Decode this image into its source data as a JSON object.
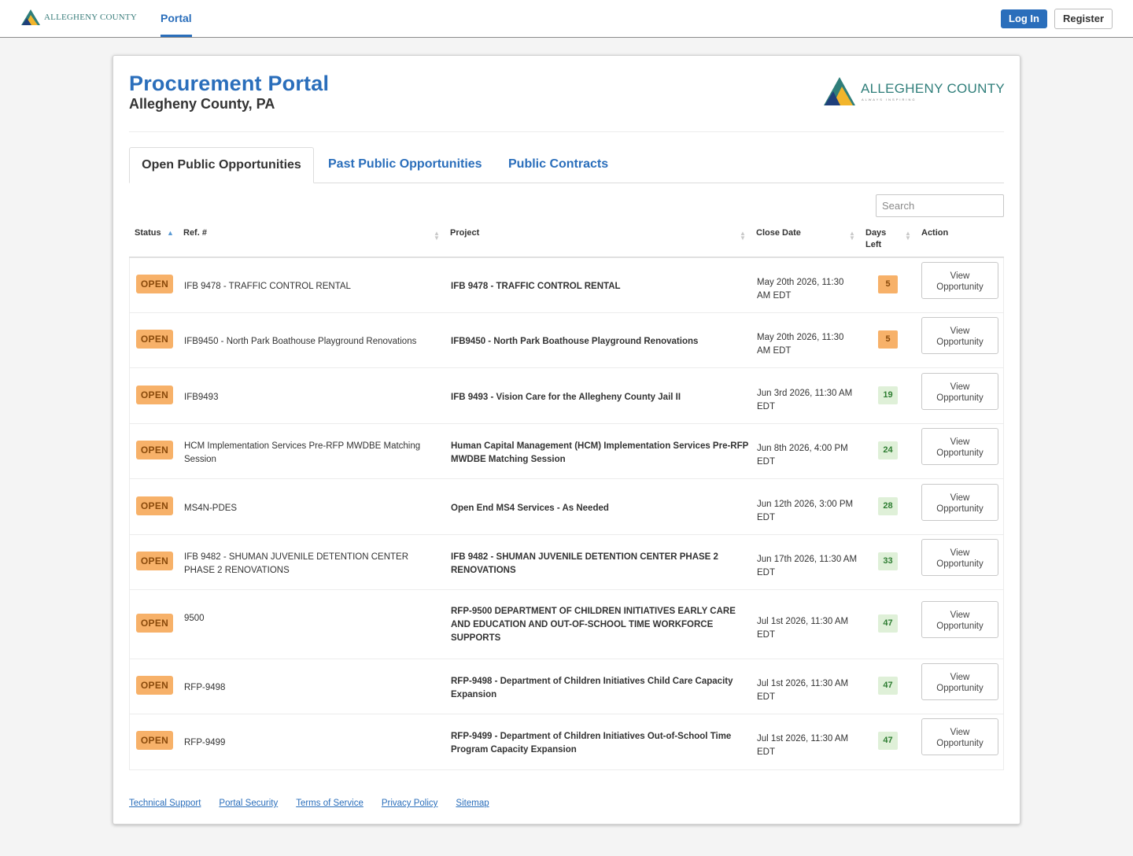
{
  "topnav": {
    "brand_text": "ALLEGHENY COUNTY",
    "brand_tag": "ALWAYS INSPIRING",
    "portal_label": "Portal",
    "login_label": "Log In",
    "register_label": "Register"
  },
  "header": {
    "title": "Procurement Portal",
    "subtitle": "Allegheny County, PA",
    "logo_text": "ALLEGHENY COUNTY",
    "logo_tag": "ALWAYS INSPIRING"
  },
  "tabs": [
    {
      "label": "Open Public Opportunities",
      "active": true
    },
    {
      "label": "Past Public Opportunities",
      "active": false
    },
    {
      "label": "Public Contracts",
      "active": false
    }
  ],
  "search": {
    "placeholder": "Search"
  },
  "table": {
    "columns": {
      "status": "Status",
      "ref": "Ref. #",
      "project": "Project",
      "close_date": "Close Date",
      "days_left_1": "Days",
      "days_left_2": "Left",
      "action": "Action"
    },
    "action_line1": "View",
    "action_line2": "Opportunity",
    "rows": [
      {
        "status": "OPEN",
        "ref": "IFB 9478 - TRAFFIC CONTROL RENTAL",
        "project": "IFB 9478 - TRAFFIC CONTROL RENTAL",
        "close": "May 20th 2026, 11:30 AM EDT",
        "days": "5",
        "urgency": "warn"
      },
      {
        "status": "OPEN",
        "ref": "IFB9450 - North Park Boathouse Playground Renovations",
        "project": "IFB9450 - North Park Boathouse Playground Renovations",
        "close": "May 20th 2026, 11:30 AM EDT",
        "days": "5",
        "urgency": "warn"
      },
      {
        "status": "OPEN",
        "ref": "IFB9493",
        "project": "IFB 9493 - Vision Care for the Allegheny County Jail II",
        "close": "Jun 3rd 2026, 11:30 AM EDT",
        "days": "19",
        "urgency": "ok"
      },
      {
        "status": "OPEN",
        "ref": "HCM Implementation Services Pre-RFP MWDBE Matching Session",
        "project": "Human Capital Management (HCM) Implementation Services Pre-RFP MWDBE Matching Session",
        "close": "Jun 8th 2026, 4:00 PM EDT",
        "days": "24",
        "urgency": "ok"
      },
      {
        "status": "OPEN",
        "ref": "MS4N-PDES",
        "project": "Open End MS4 Services - As Needed",
        "close": "Jun 12th 2026, 3:00 PM EDT",
        "days": "28",
        "urgency": "ok"
      },
      {
        "status": "OPEN",
        "ref": "IFB 9482 - SHUMAN JUVENILE DETENTION CENTER PHASE 2 RENOVATIONS",
        "project": "IFB 9482 - SHUMAN JUVENILE DETENTION CENTER PHASE 2 RENOVATIONS",
        "close": "Jun 17th 2026, 11:30 AM EDT",
        "days": "33",
        "urgency": "ok"
      },
      {
        "status": "OPEN",
        "ref": "9500",
        "project": "RFP-9500 DEPARTMENT OF CHILDREN INITIATIVES EARLY CARE AND EDUCATION AND OUT-OF-SCHOOL TIME WORKFORCE SUPPORTS",
        "close": "Jul 1st 2026, 11:30 AM EDT",
        "days": "47",
        "urgency": "ok"
      },
      {
        "status": "OPEN",
        "ref": "RFP-9498",
        "project": "RFP-9498 - Department of Children Initiatives Child Care Capacity Expansion",
        "close": "Jul 1st 2026, 11:30 AM EDT",
        "days": "47",
        "urgency": "ok"
      },
      {
        "status": "OPEN",
        "ref": "RFP-9499",
        "project": "RFP-9499 - Department of Children Initiatives Out-of-School Time Program Capacity Expansion",
        "close": "Jul 1st 2026, 11:30 AM EDT",
        "days": "47",
        "urgency": "ok"
      }
    ]
  },
  "footer": {
    "links": [
      "Technical Support",
      "Portal Security",
      "Terms of Service",
      "Privacy Policy",
      "Sitemap"
    ]
  },
  "colors": {
    "brand_blue": "#2a6ebb",
    "open_badge": "#f7b169",
    "days_ok_bg": "#dff0d8",
    "days_ok_text": "#2e7d32"
  }
}
